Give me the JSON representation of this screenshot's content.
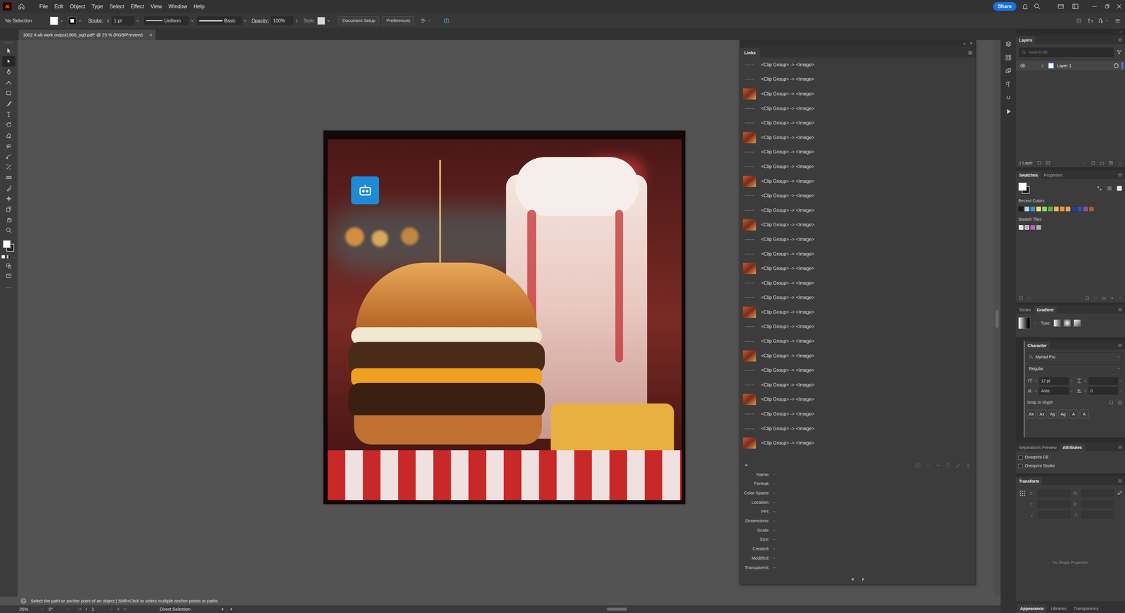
{
  "app": {
    "logo": "Ai"
  },
  "menu": [
    "File",
    "Edit",
    "Object",
    "Type",
    "Select",
    "Effect",
    "View",
    "Window",
    "Help"
  ],
  "title_bar": {
    "share": "Share"
  },
  "control_bar": {
    "selection": "No Selection",
    "stroke_label": "Stroke:",
    "stroke_weight": "1 pt",
    "stroke_profile": "Uniform",
    "brush": "Basic",
    "opacity_label": "Opacity:",
    "opacity": "100%",
    "style_label": "Style:",
    "document_setup": "Document Setup",
    "preferences": "Preferences"
  },
  "document_tab": {
    "title": "1002 4 ab work output1000_pg0.pdf* @ 25 % (RGB/Preview)",
    "close": "×",
    "selected": true
  },
  "tools": [
    {
      "selected": false
    },
    {
      "selected": true
    },
    {
      "selected": false
    },
    {
      "selected": false
    },
    {
      "selected": false
    },
    {
      "selected": false
    },
    {
      "selected": false
    },
    {
      "selected": false
    },
    {
      "selected": false
    },
    {
      "selected": false
    },
    {
      "selected": false
    },
    {
      "selected": false
    },
    {
      "selected": false
    },
    {
      "selected": false
    },
    {
      "selected": false
    },
    {
      "selected": false
    },
    {
      "selected": false
    },
    {
      "selected": false
    }
  ],
  "toolbar_more": "···",
  "links_panel": {
    "collapse": "»",
    "close": "×",
    "title": "Links",
    "rows": [
      {
        "label": "<Clip Group> -> <Image>",
        "kind": "link"
      },
      {
        "label": "<Clip Group> -> <Image>",
        "kind": "link"
      },
      {
        "label": "<Clip Group> -> <Image>",
        "kind": "thumb"
      },
      {
        "label": "<Clip Group> -> <Image>",
        "kind": "link"
      },
      {
        "label": "<Clip Group> -> <Image>",
        "kind": "link"
      },
      {
        "label": "<Clip Group> -> <Image>",
        "kind": "thumb"
      },
      {
        "label": "<Clip Group> -> <Image>",
        "kind": "link"
      },
      {
        "label": "<Clip Group> -> <Image>",
        "kind": "link"
      },
      {
        "label": "<Clip Group> -> <Image>",
        "kind": "thumb"
      },
      {
        "label": "<Clip Group> -> <Image>",
        "kind": "link"
      },
      {
        "label": "<Clip Group> -> <Image>",
        "kind": "link"
      },
      {
        "label": "<Clip Group> -> <Image>",
        "kind": "thumb"
      },
      {
        "label": "<Clip Group> -> <Image>",
        "kind": "link"
      },
      {
        "label": "<Clip Group> -> <Image>",
        "kind": "link"
      },
      {
        "label": "<Clip Group> -> <Image>",
        "kind": "thumb"
      },
      {
        "label": "<Clip Group> -> <Image>",
        "kind": "link"
      },
      {
        "label": "<Clip Group> -> <Image>",
        "kind": "link"
      },
      {
        "label": "<Clip Group> -> <Image>",
        "kind": "thumb"
      },
      {
        "label": "<Clip Group> -> <Image>",
        "kind": "link"
      },
      {
        "label": "<Clip Group> -> <Image>",
        "kind": "link"
      },
      {
        "label": "<Clip Group> -> <Image>",
        "kind": "thumb"
      },
      {
        "label": "<Clip Group> -> <Image>",
        "kind": "link"
      },
      {
        "label": "<Clip Group> -> <Image>",
        "kind": "link"
      },
      {
        "label": "<Clip Group> -> <Image>",
        "kind": "thumb"
      },
      {
        "label": "<Clip Group> -> <Image>",
        "kind": "link"
      },
      {
        "label": "<Clip Group> -> <Image>",
        "kind": "link"
      },
      {
        "label": "<Clip Group> -> <Image>",
        "kind": "thumb"
      }
    ],
    "info": [
      {
        "label": "Name:",
        "value": "-"
      },
      {
        "label": "Format:",
        "value": "-"
      },
      {
        "label": "Color Space:",
        "value": "-"
      },
      {
        "label": "Location:",
        "value": "-"
      },
      {
        "label": "PPI:",
        "value": "-"
      },
      {
        "label": "Dimensions:",
        "value": "-"
      },
      {
        "label": "Scale:",
        "value": "-"
      },
      {
        "label": "Size:",
        "value": "-"
      },
      {
        "label": "Created:",
        "value": "-"
      },
      {
        "label": "Modified:",
        "value": "-"
      },
      {
        "label": "Transparent:",
        "value": "-"
      }
    ]
  },
  "layers_panel": {
    "title": "Layers",
    "search_placeholder": "Search All",
    "layers": [
      {
        "name": "Layer 1",
        "visible": true,
        "expanded": false,
        "selected": true
      }
    ],
    "count": "1 Layer"
  },
  "swatches_panel": {
    "tabs": [
      {
        "label": "Swatches",
        "selected": true
      },
      {
        "label": "Properties",
        "selected": false
      }
    ],
    "recent_label": "Recent Colors",
    "recent_colors": [
      {
        "color": "#1a1a1a"
      },
      {
        "color": "#a8d8f0"
      },
      {
        "color": "#3c8fd8"
      },
      {
        "color": "#f0e060"
      },
      {
        "color": "#90d070"
      },
      {
        "color": "#60b040"
      },
      {
        "color": "#f0b060"
      },
      {
        "color": "#f09040"
      },
      {
        "color": "#e8a050"
      },
      {
        "color": "#2040a0"
      },
      {
        "color": "#3050b0"
      },
      {
        "color": "#8050a0"
      },
      {
        "color": "#a06030"
      }
    ],
    "tiles_label": "Swatch Tiles",
    "tiles": [
      {
        "kind": "none",
        "color": "#ffffff"
      },
      {
        "kind": "pattern",
        "color": "#d0d0d0"
      },
      {
        "kind": "color",
        "color": "#c060c0"
      },
      {
        "kind": "color",
        "color": "#b0b0b0"
      }
    ]
  },
  "gradient_panel": {
    "tabs": [
      {
        "label": "Stroke",
        "selected": false
      },
      {
        "label": "Gradient",
        "selected": true
      }
    ],
    "type_label": "Type:"
  },
  "character_panel": {
    "title": "Character",
    "font": "Myriad Pro",
    "style": "Regular",
    "size": "12 pt",
    "leading": "Auto",
    "tracking": "0",
    "snap_label": "Snap to Glyph",
    "glyph_buttons": [
      "Ax",
      "Ax",
      "Ag",
      "Ag",
      "A",
      "A"
    ]
  },
  "attributes_panel": {
    "tabs": [
      {
        "label": "Separations Preview",
        "selected": false
      },
      {
        "label": "Attributes",
        "selected": true
      }
    ],
    "options": [
      {
        "label": "Overprint Fill",
        "checked": false
      },
      {
        "label": "Overprint Stroke",
        "checked": false
      }
    ]
  },
  "transform_panel": {
    "title": "Transform",
    "fields": [
      "X:",
      "W:",
      "Y:",
      "H:"
    ],
    "empty_message": "No Shape Properties"
  },
  "bottom_tabs": [
    {
      "label": "Appearance",
      "selected": true
    },
    {
      "label": "Libraries",
      "selected": false
    },
    {
      "label": "Transparency",
      "selected": false
    }
  ],
  "status_bar": {
    "hint_icon": "?",
    "hint": "Select the path or anchor point of an object | Shift+Click to select multiple anchor points or paths",
    "zoom": "25%",
    "rotation": "0°",
    "artboard": "1",
    "tool": "Direct Selection"
  }
}
